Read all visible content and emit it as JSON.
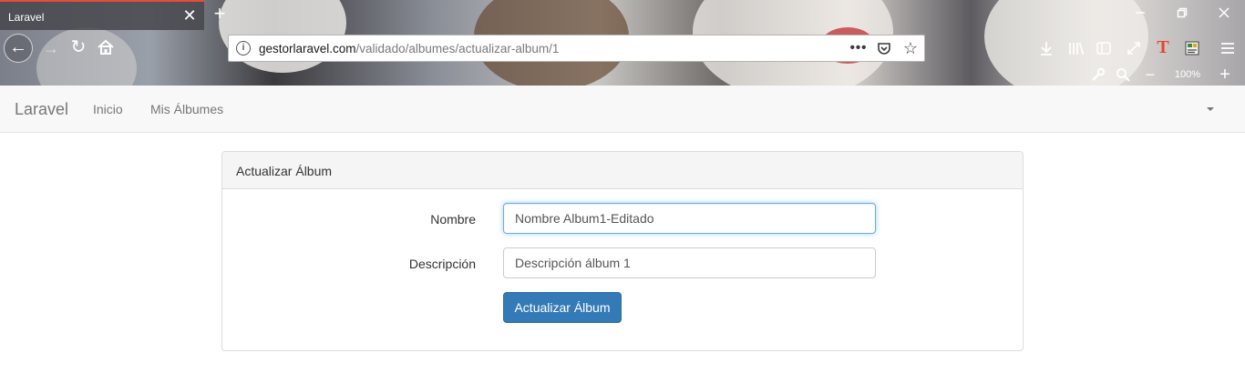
{
  "browser": {
    "tab_title": "Laravel",
    "tab_close": "✕",
    "new_tab": "+",
    "url_host": "gestorlaravel.com",
    "url_path": "/validado/albumes/actualizar-album/1",
    "zoom_level": "100%",
    "zoom_out": "−",
    "zoom_in": "+",
    "icons": [
      "back-icon",
      "forward-icon",
      "reload-icon",
      "home-icon",
      "site-info-icon",
      "page-actions-icon",
      "pocket-icon",
      "bookmark-star-icon",
      "download-icon",
      "library-icon",
      "sidebar-icon",
      "fullscreen-icon",
      "extension-t-icon",
      "extension-notes-icon",
      "menu-icon",
      "wrench-icon",
      "search-icon"
    ]
  },
  "navbar": {
    "brand": "Laravel",
    "links": [
      "Inicio",
      "Mis Álbumes"
    ]
  },
  "panel": {
    "heading": "Actualizar Álbum",
    "fields": [
      {
        "label": "Nombre",
        "value": "Nombre Album1-Editado"
      },
      {
        "label": "Descripción",
        "value": "Descripción álbum 1"
      }
    ],
    "submit_label": "Actualizar Álbum"
  },
  "colors": {
    "primary_button": "#337ab7",
    "focus_border": "#66afe9",
    "tab_accent": "#e94a3a"
  }
}
